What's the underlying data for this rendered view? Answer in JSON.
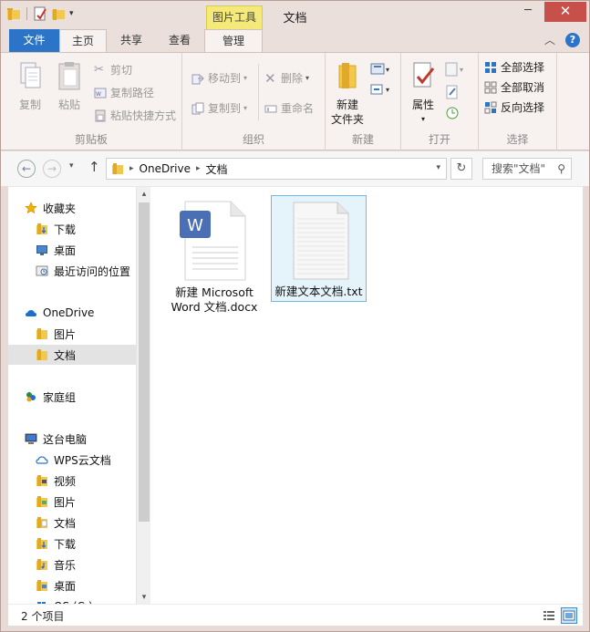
{
  "window": {
    "title": "文档",
    "context_tab": "图片工具",
    "minimize": "─",
    "maximize": "□",
    "close": "✕"
  },
  "tabs": {
    "file": "文件",
    "home": "主页",
    "share": "共享",
    "view": "查看",
    "manage": "管理",
    "help": "?"
  },
  "ribbon": {
    "clipboard": {
      "name": "剪贴板",
      "copy": "复制",
      "paste": "粘贴",
      "cut": "剪切",
      "copy_path": "复制路径",
      "paste_shortcut": "粘贴快捷方式"
    },
    "organize": {
      "name": "组织",
      "move_to": "移动到",
      "copy_to": "复制到",
      "delete": "删除",
      "rename": "重命名"
    },
    "new": {
      "name": "新建",
      "new_folder_line1": "新建",
      "new_folder_line2": "文件夹"
    },
    "open": {
      "name": "打开",
      "properties": "属性"
    },
    "select": {
      "name": "选择",
      "select_all": "全部选择",
      "select_none": "全部取消",
      "invert": "反向选择"
    }
  },
  "address": {
    "crumbs": [
      "OneDrive",
      "文档"
    ],
    "search_placeholder": "搜索\"文档\""
  },
  "sidebar": {
    "items": [
      {
        "label": "收藏夹",
        "icon": "star-icon"
      },
      {
        "label": "下载",
        "icon": "download-folder-icon"
      },
      {
        "label": "桌面",
        "icon": "desktop-icon"
      },
      {
        "label": "最近访问的位置",
        "icon": "recent-places-icon"
      },
      {
        "label": "OneDrive",
        "icon": "onedrive-icon"
      },
      {
        "label": "图片",
        "icon": "folder-icon"
      },
      {
        "label": "文档",
        "icon": "folder-icon"
      },
      {
        "label": "家庭组",
        "icon": "homegroup-icon"
      },
      {
        "label": "这台电脑",
        "icon": "computer-icon"
      },
      {
        "label": "WPS云文档",
        "icon": "cloud-icon"
      },
      {
        "label": "视频",
        "icon": "video-folder-icon"
      },
      {
        "label": "图片",
        "icon": "pictures-folder-icon"
      },
      {
        "label": "文档",
        "icon": "documents-folder-icon"
      },
      {
        "label": "下载",
        "icon": "download-folder-icon"
      },
      {
        "label": "音乐",
        "icon": "music-folder-icon"
      },
      {
        "label": "桌面",
        "icon": "desktop-folder-icon"
      },
      {
        "label": "OS (C:)",
        "icon": "drive-icon"
      }
    ]
  },
  "files": [
    {
      "line1": "新建 Microsoft",
      "line2": "Word 文档.docx",
      "icon": "wps-word-icon",
      "selected": false
    },
    {
      "line1": "新建文本文档.txt",
      "line2": "",
      "icon": "text-file-icon",
      "selected": true
    }
  ],
  "status": {
    "item_count": "2 个项目"
  },
  "colors": {
    "file_tab": "#2b74c7",
    "context_tab": "#f5e97a",
    "close_button": "#c7504a",
    "selection": "#e5f3fb"
  }
}
